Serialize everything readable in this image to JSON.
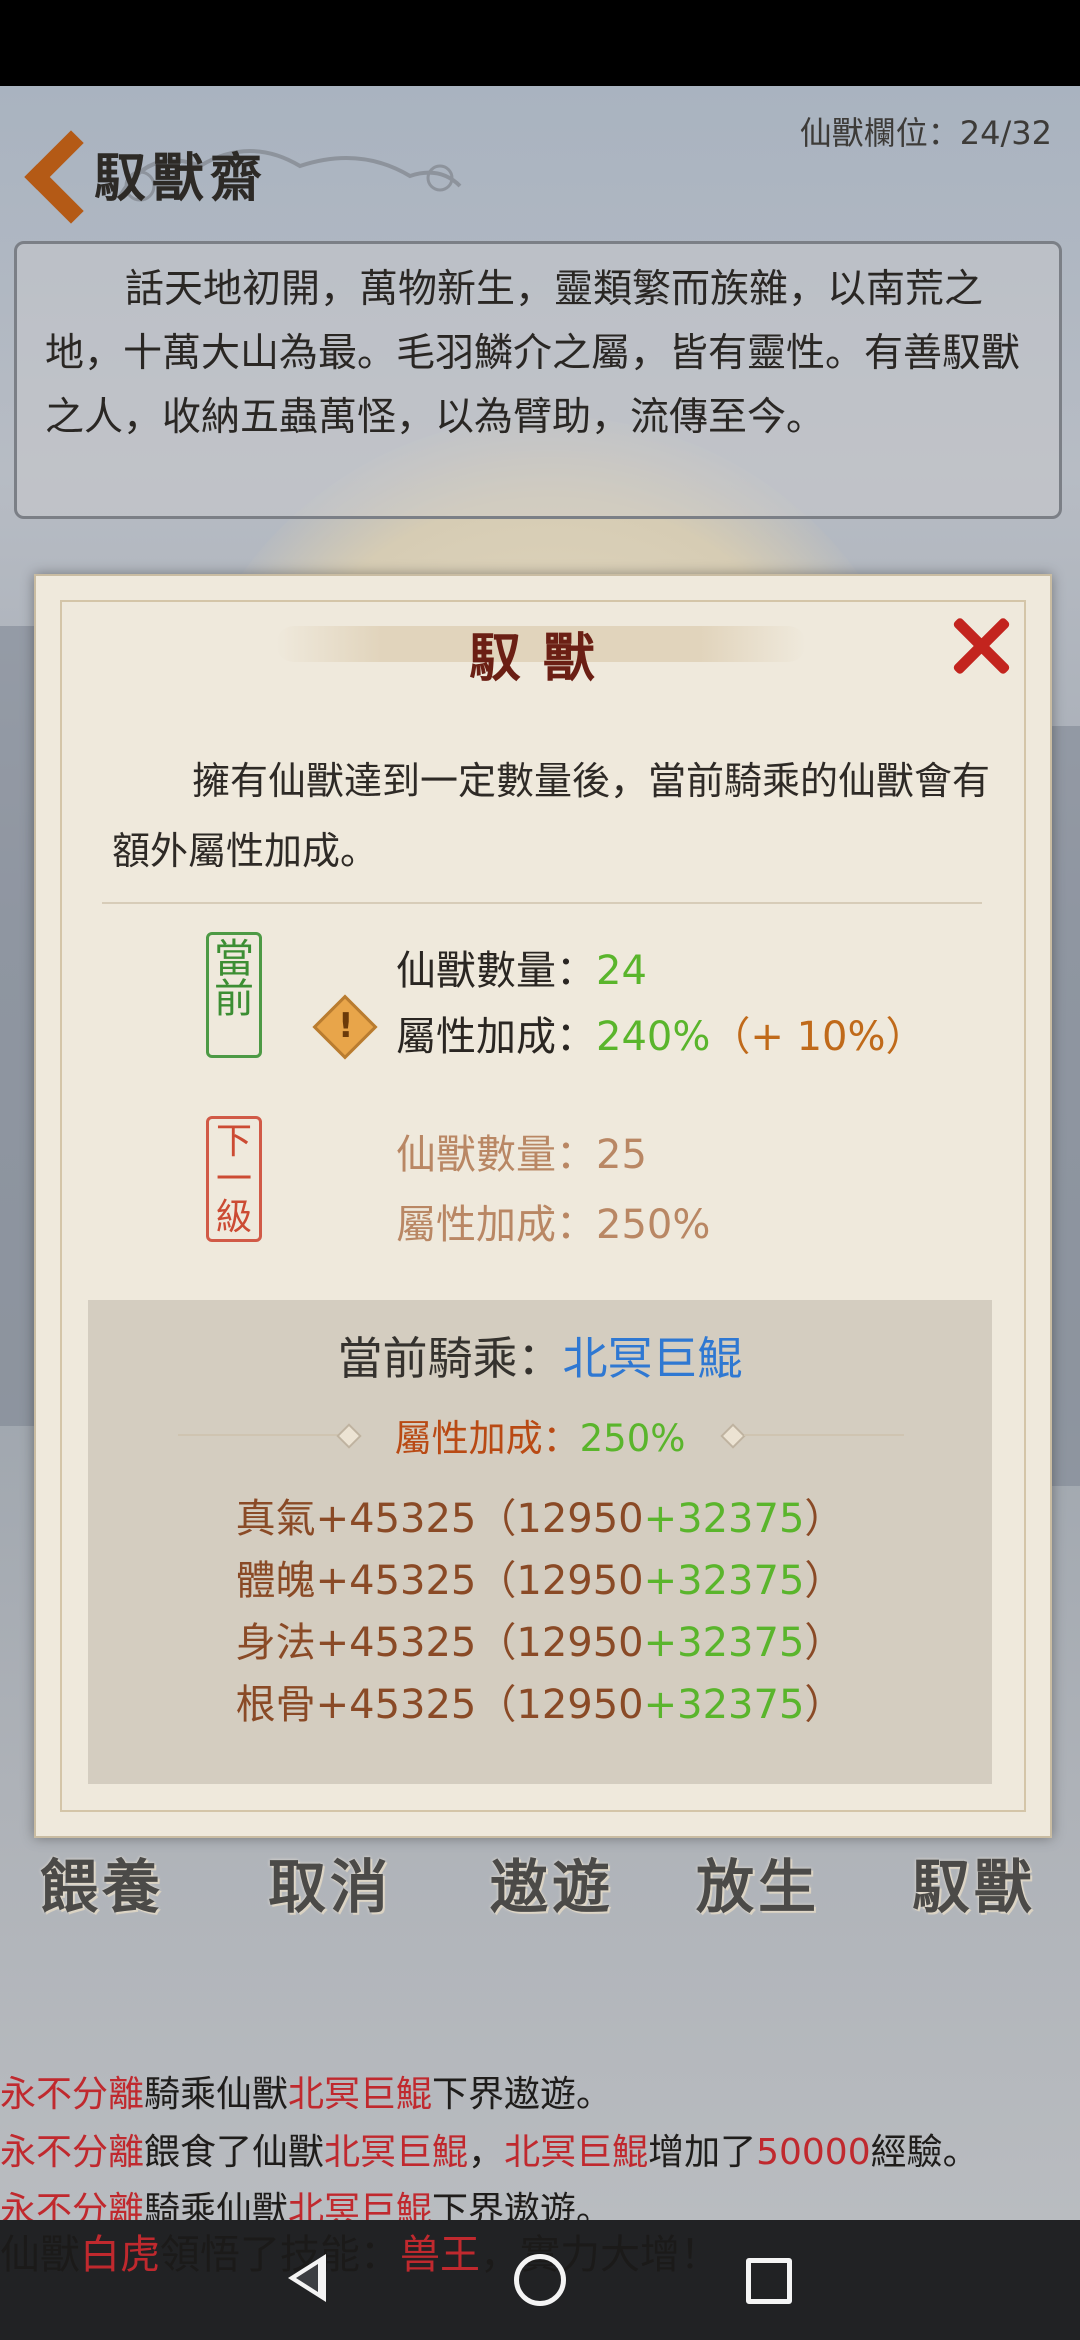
{
  "header": {
    "title": "馭獸齋",
    "slot_counter": "仙獸欄位：24/32"
  },
  "intro": {
    "text": "話天地初開，萬物新生，靈類繁而族雜，以南荒之地，十萬大山為最。毛羽鱗介之屬，皆有靈性。有善馭獸之人，收納五蟲萬怪，以為臂助，流傳至今。"
  },
  "dialog": {
    "title": "馭獸",
    "description": "擁有仙獸達到一定數量後，當前騎乘的仙獸會有額外屬性加成。",
    "current_stamp": "當前",
    "next_stamp": "下一級",
    "current": {
      "count_label": "仙獸數量：",
      "count_value": "24",
      "bonus_label": "屬性加成：",
      "bonus_value": "240%",
      "bonus_extra": "（+ 10%）"
    },
    "next": {
      "count_label": "仙獸數量：",
      "count_value": "25",
      "bonus_label": "屬性加成：",
      "bonus_value": "250%"
    },
    "ride": {
      "label": "當前騎乘：",
      "mount_name": "北冥巨鯤",
      "bonus_label": "屬性加成：",
      "bonus_value": "250%",
      "stats": [
        {
          "name": "真氣",
          "total": "+45325",
          "base": "12950",
          "extra": "+32375"
        },
        {
          "name": "體魄",
          "total": "+45325",
          "base": "12950",
          "extra": "+32375"
        },
        {
          "name": "身法",
          "total": "+45325",
          "base": "12950",
          "extra": "+32375"
        },
        {
          "name": "根骨",
          "total": "+45325",
          "base": "12950",
          "extra": "+32375"
        }
      ]
    }
  },
  "menu": {
    "feed": "餵養",
    "cancel": "取消",
    "roam": "遨遊",
    "release": "放生",
    "tame": "馭獸"
  },
  "log": {
    "line1": {
      "player": "永不分離",
      "a": "騎乘仙獸",
      "beast": "北冥巨鯤",
      "b": "下界遨遊。"
    },
    "line2": {
      "player": "永不分離",
      "a": "餵食了仙獸",
      "beast": "北冥巨鯤",
      "sep": "，",
      "beast2": "北冥巨鯤",
      "b": "增加了",
      "exp": "50000",
      "c": "經驗。"
    },
    "line3": {
      "player": "永不分離",
      "a": "騎乘仙獸",
      "beast": "北冥巨鯤",
      "b": "下界遨遊。"
    },
    "line4": {
      "a": "仙獸",
      "beast": "白虎",
      "b": "領悟了技能：",
      "skill": "兽王",
      "c": "，實力大增！"
    }
  },
  "colors": {
    "accent_red": "#c0292e",
    "accent_green": "#5ab52c",
    "accent_blue": "#2f78d2",
    "title_red": "#6b1f14"
  }
}
